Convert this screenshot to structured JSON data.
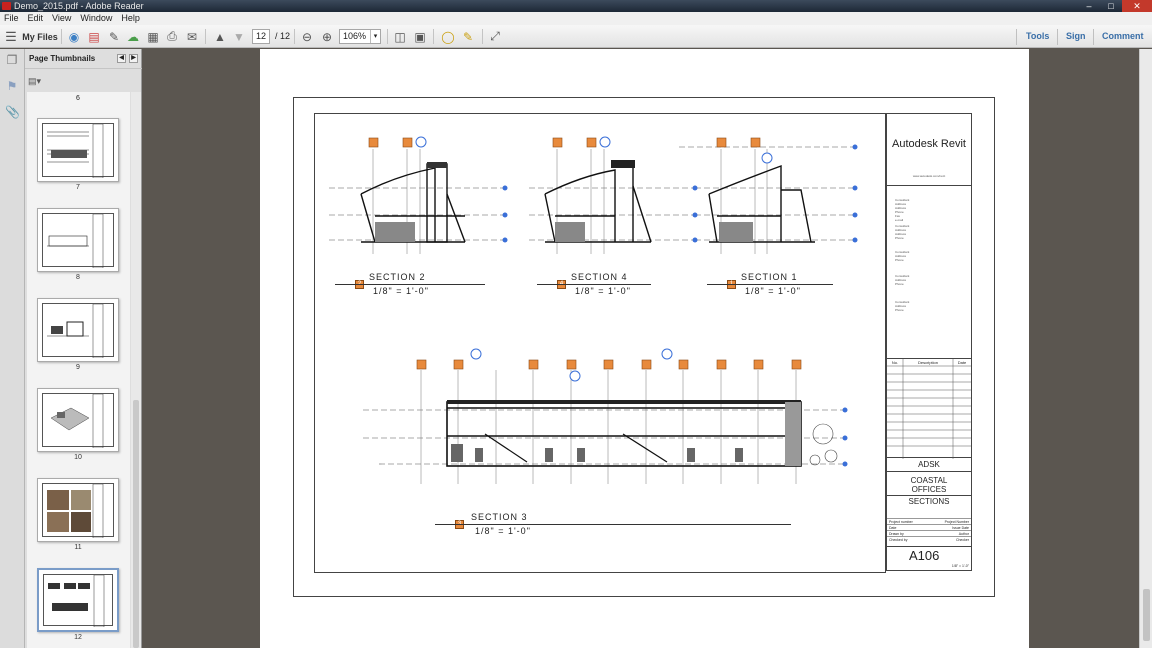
{
  "window": {
    "title": "Demo_2015.pdf - Adobe Reader"
  },
  "menu": [
    "File",
    "Edit",
    "View",
    "Window",
    "Help"
  ],
  "toolbar": {
    "my_files": "My Files",
    "page_current": "12",
    "page_total": "/ 12",
    "zoom": "106%",
    "tools": "Tools",
    "sign": "Sign",
    "comment": "Comment"
  },
  "thumbnails": {
    "header": "Page Thumbnails",
    "top_label": "6",
    "labels": [
      "7",
      "8",
      "9",
      "10",
      "11",
      "12"
    ]
  },
  "document": {
    "brand": "Autodesk Revit",
    "brand_url": "www.autodesk.com/revit",
    "consultant_lines": [
      "Consultant",
      "Address",
      "Address",
      "Phone",
      "Fax",
      "e-mail"
    ],
    "rev_headers": [
      "No.",
      "Description",
      "Date"
    ],
    "project_lines": [
      "ADSK",
      "COASTAL",
      "OFFICES",
      "SECTIONS"
    ],
    "info_rows": [
      [
        "Project number",
        "Project Number"
      ],
      [
        "Date",
        "Issue Date"
      ],
      [
        "Drawn by",
        "Author"
      ],
      [
        "Checked by",
        "Checker"
      ]
    ],
    "sheet_number": "A106",
    "scale": "1/8\" = 1'-0\"",
    "sections": [
      {
        "num": "2",
        "title": "SECTION 2",
        "scale": "1/8\" = 1'-0\""
      },
      {
        "num": "4",
        "title": "SECTION 4",
        "scale": "1/8\" = 1'-0\""
      },
      {
        "num": "1",
        "title": "SECTION 1",
        "scale": "1/8\" = 1'-0\""
      },
      {
        "num": "3",
        "title": "SECTION 3",
        "scale": "1/8\" = 1'-0\""
      }
    ]
  },
  "colors": {
    "grid_marker": "#e88a3c",
    "level_marker": "#3a6fd8",
    "reader_accent": "#3a6fa8"
  }
}
